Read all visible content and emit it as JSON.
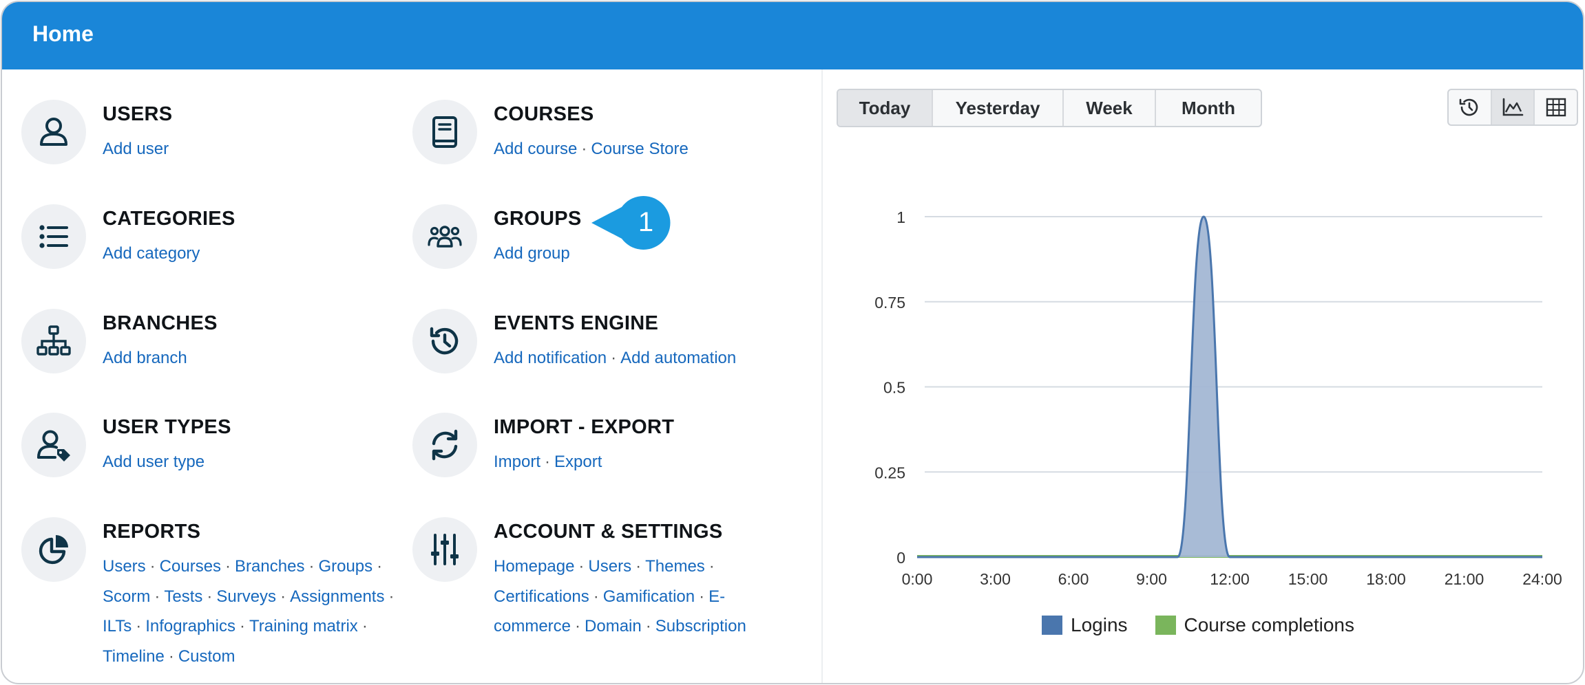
{
  "header": {
    "title": "Home"
  },
  "sections": [
    {
      "key": "users",
      "heading": "USERS",
      "icon": "user-icon",
      "lines": [
        [
          "Add user"
        ]
      ]
    },
    {
      "key": "courses",
      "heading": "COURSES",
      "icon": "book-icon",
      "lines": [
        [
          "Add course",
          "Course Store"
        ]
      ]
    },
    {
      "key": "categories",
      "heading": "CATEGORIES",
      "icon": "list-icon",
      "lines": [
        [
          "Add category"
        ]
      ]
    },
    {
      "key": "groups",
      "heading": "GROUPS",
      "icon": "group-icon",
      "lines": [
        [
          "Add group"
        ]
      ]
    },
    {
      "key": "branches",
      "heading": "BRANCHES",
      "icon": "sitemap-icon",
      "lines": [
        [
          "Add branch"
        ]
      ]
    },
    {
      "key": "events",
      "heading": "EVENTS ENGINE",
      "icon": "history-icon",
      "lines": [
        [
          "Add notification",
          "Add automation"
        ]
      ]
    },
    {
      "key": "usertypes",
      "heading": "USER TYPES",
      "icon": "user-tag-icon",
      "lines": [
        [
          "Add user type"
        ]
      ]
    },
    {
      "key": "importexport",
      "heading": "IMPORT - EXPORT",
      "icon": "sync-icon",
      "lines": [
        [
          "Import",
          "Export"
        ]
      ]
    },
    {
      "key": "reports",
      "heading": "REPORTS",
      "icon": "pie-chart-icon",
      "lines": [
        [
          "Users",
          "Courses",
          "Branches",
          "Groups",
          ""
        ],
        [
          "Scorm",
          "Tests",
          "Surveys",
          "Assignments",
          ""
        ],
        [
          "ILTs",
          "Infographics",
          "Training matrix",
          ""
        ],
        [
          "Timeline",
          "Custom"
        ]
      ]
    },
    {
      "key": "account",
      "heading": "ACCOUNT & SETTINGS",
      "icon": "sliders-icon",
      "lines": [
        [
          "Homepage",
          "Users",
          "Themes",
          ""
        ],
        [
          "Certifications",
          "Gamification",
          "E-"
        ],
        [
          "commerce",
          "Domain",
          "Subscription"
        ]
      ]
    }
  ],
  "callout": {
    "number": "1"
  },
  "period_tabs": [
    {
      "label": "Today",
      "active": true
    },
    {
      "label": "Yesterday",
      "active": false
    },
    {
      "label": "Week",
      "active": false
    },
    {
      "label": "Month",
      "active": false
    }
  ],
  "view_buttons": [
    {
      "icon": "history-icon",
      "active": false
    },
    {
      "icon": "area-chart-icon",
      "active": true
    },
    {
      "icon": "table-grid-icon",
      "active": false
    }
  ],
  "chart_data": {
    "type": "area",
    "x_ticks": [
      "0:00",
      "3:00",
      "6:00",
      "9:00",
      "12:00",
      "15:00",
      "18:00",
      "21:00",
      "24:00"
    ],
    "y_ticks": [
      "0",
      "0.25",
      "0.5",
      "0.75",
      "1"
    ],
    "ylim": [
      0,
      1
    ],
    "xlim": [
      0,
      24
    ],
    "grid": true,
    "legend_position": "bottom",
    "series": [
      {
        "name": "Logins",
        "color": "#4a76ad",
        "fill": "#a3b7d4",
        "points": [
          [
            0,
            0
          ],
          [
            9,
            0
          ],
          [
            10,
            0
          ],
          [
            11,
            1
          ],
          [
            12,
            0
          ],
          [
            24,
            0
          ]
        ]
      },
      {
        "name": "Course completions",
        "color": "#7ab55c",
        "fill": "#7ab55c",
        "points": [
          [
            0,
            0
          ],
          [
            24,
            0
          ]
        ]
      }
    ]
  }
}
